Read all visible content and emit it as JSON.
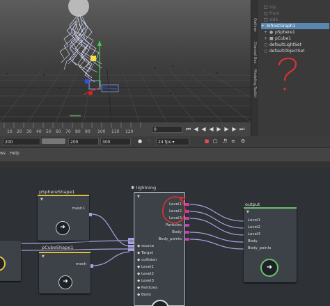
{
  "outliner": {
    "tabs": [
      "Outliner",
      "Channel Box",
      "Modeling Toolkit"
    ],
    "items": [
      {
        "label": "top",
        "dim": true
      },
      {
        "label": "front",
        "dim": true
      },
      {
        "label": "side",
        "dim": true
      },
      {
        "label": "bifrostGraph1",
        "selected": true
      },
      {
        "label": "pSphere1"
      },
      {
        "label": "pCube1"
      },
      {
        "label": "defaultLightSet"
      },
      {
        "label": "defaultObjectSet"
      }
    ]
  },
  "timeline": {
    "ticks": [
      "10",
      "20",
      "30",
      "40",
      "50",
      "60",
      "70",
      "80",
      "90",
      "100",
      "110",
      "120"
    ],
    "current_frame": "0"
  },
  "range": {
    "start": "200",
    "end": "200",
    "end2": "300",
    "fps": "24 fps"
  },
  "menu": {
    "items": [
      "ws",
      "Help"
    ]
  },
  "graph": {
    "pSphereShape1": {
      "title": "pSphereShape1",
      "port": "mesh1"
    },
    "pCubeShape1": {
      "title": "pCubeShape1",
      "port": "mesh"
    },
    "lightning": {
      "title": "lightning",
      "inputs": [
        "source",
        "Target",
        "collision",
        "Level1",
        "Level2",
        "Level3",
        "Particles",
        "Body"
      ],
      "outputs": [
        "Level1",
        "Level2",
        "Level3",
        "Particles",
        "Body",
        "Body_points"
      ]
    },
    "output": {
      "title": "output",
      "inputs": [
        "Level1",
        "Level2",
        "Level3",
        "Body",
        "Body_points"
      ]
    }
  },
  "colors": {
    "sphere_header": "#e0c040",
    "cube_header": "#e0c040",
    "lightning_border": "#bfc8d0",
    "output_header": "#6cc070",
    "wire": "#a9a0e0",
    "output_port": "#c040b0",
    "annotation_red": "#e03030",
    "selection": "#5b86b0"
  },
  "annotation": {
    "note": "?"
  }
}
